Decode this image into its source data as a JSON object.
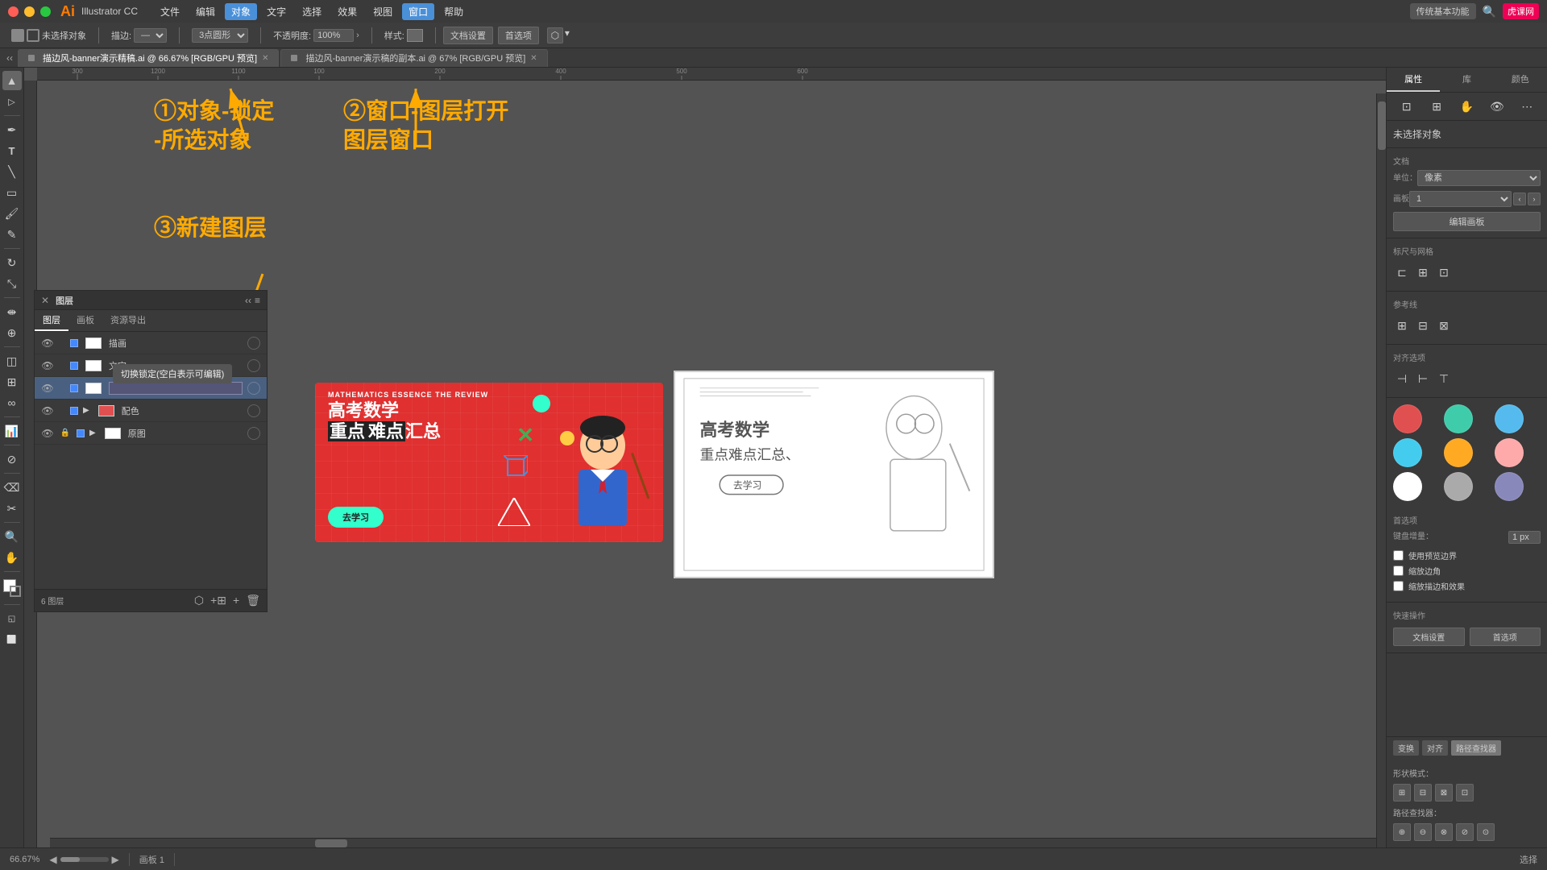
{
  "app": {
    "name": "Illustrator CC",
    "logo": "Ai",
    "version": "CC"
  },
  "titlebar": {
    "menus": [
      "文件",
      "编辑",
      "对象",
      "文字",
      "选择",
      "效果",
      "视图",
      "窗口",
      "帮助"
    ],
    "right_btn": "传统基本功能",
    "logo_site": "虎课网"
  },
  "toolbar": {
    "label_unselected": "未选择对象",
    "stroke_label": "描边:",
    "shape_label": "3点圆形",
    "opacity_label": "不透明度:",
    "opacity_value": "100%",
    "style_label": "样式:",
    "doc_settings_btn": "文档设置",
    "preferences_btn": "首选项"
  },
  "tabs": [
    {
      "label": "描边风-banner演示精稿.ai @ 66.67% [RGB/GPU 预览]",
      "active": true
    },
    {
      "label": "描边风-banner演示稿的副本.ai @ 67% [RGB/GPU 预览]",
      "active": false
    }
  ],
  "annotations": {
    "ann1_title": "①对象-锁定",
    "ann1_sub": "-所选对象",
    "ann2_title": "②窗口-图层打开",
    "ann2_sub": "图层窗口",
    "ann3_title": "③新建图层"
  },
  "layers_panel": {
    "title": "图层",
    "tabs": [
      "图层",
      "画板",
      "资源导出"
    ],
    "layers": [
      {
        "name": "描画",
        "visible": true,
        "locked": false,
        "color": "#4488ff",
        "has_children": false
      },
      {
        "name": "文字",
        "visible": true,
        "locked": false,
        "color": "#4488ff",
        "has_children": false
      },
      {
        "name": "",
        "visible": true,
        "locked": false,
        "color": "#4488ff",
        "has_children": false,
        "editing": true
      },
      {
        "name": "配色",
        "visible": true,
        "locked": false,
        "color": "#4488ff",
        "has_children": true
      },
      {
        "name": "原图",
        "visible": true,
        "locked": true,
        "color": "#4488ff",
        "has_children": true
      }
    ],
    "count": "6 图层",
    "tooltip": "切换锁定(空白表示可编辑)"
  },
  "banner": {
    "subtitle": "MATHEMATICS ESSENCE THE REVIEW",
    "title_zh1": "高考数学",
    "title_zh2": "重点难点汇总",
    "btn_label": "去学习",
    "cross": "✕"
  },
  "right_panel": {
    "tabs": [
      "属性",
      "库",
      "颜色"
    ],
    "active_tab": "属性",
    "unselected_label": "未选择对象",
    "doc_section": "文档",
    "unit_label": "单位：",
    "unit_value": "像素",
    "artboard_label": "画板",
    "artboard_value": "1",
    "edit_artboard_btn": "编辑画板",
    "grid_align_label": "标尺与网格",
    "guides_label": "参考线",
    "align_label": "对齐选项",
    "first_pref_label": "首选项",
    "keyboard_inc_label": "键盘增量：",
    "keyboard_inc_value": "1 px",
    "snap_edges_label": "使用预览边界",
    "corner_label": "缩放边角",
    "scale_stroke_label": "缩放描边和效果",
    "quick_ops_label": "快速操作",
    "doc_settings_btn": "文档设置",
    "preferences_btn": "首选项",
    "colors": [
      "#e05050",
      "#3fccaa",
      "#55bbee",
      "#44ccee",
      "#ffaa22",
      "#ffaaaa",
      "#ffffff",
      "#aaaaaa",
      "#8888bb"
    ],
    "bottom_tabs": [
      "变换",
      "对齐",
      "路径查找器"
    ],
    "active_bottom_tab": "路径查找器",
    "shape_modes_label": "形状模式：",
    "path_finders_label": "路径查找器："
  },
  "statusbar": {
    "zoom": "66.67%",
    "artboard": "1",
    "tool": "选择"
  }
}
